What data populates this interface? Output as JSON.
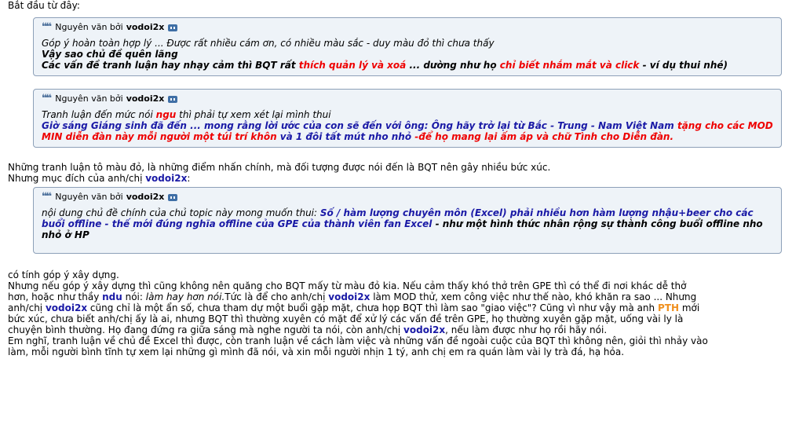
{
  "intro": "Bắt đầu từ đây:",
  "quote_prefix": "Nguyên văn bởi",
  "quote_author": "vodoi2x",
  "quote1": {
    "l1": "Góp ý hoàn toàn hợp lý ... Được rất nhiều cám ơn, có nhiều màu sắc - duy màu đỏ thì chưa thấy",
    "l2": "Vậy sao chủ đề quên lãng",
    "l3a": "Các vấn đề tranh luận hay nhạy cảm thì BQT rất ",
    "l3b": "thích quản lý và xoá",
    "l3c": " ... dường như họ ",
    "l3d": "chỉ biết nhắm mắt và click",
    "l3e": " - ví dụ thui nhé)"
  },
  "quote2": {
    "l1a": "Tranh luận đến mức nói ",
    "l1b": "ngu",
    "l1c": " thì phải tự xem xét lại mình thui",
    "l2a": "Giờ sáng Giáng sinh đã đến ... mong rằng lời ước của con sẽ đến với ông: Ông hãy trở lại từ Bắc - Trung - Nam Việt Nam ",
    "l2b": "tặng cho các MOD",
    "l3a": "MIN diễn đàn này mỗi người một túi trí khôn",
    "l3b": " và 1 đôi tất mút nho nhỏ ",
    "l3c": "-để họ mang lại ấm áp và chữ Tình cho Diễn đàn."
  },
  "para1": "Những tranh luận tô màu đỏ, là những điểm nhấn chính, mà đối tượng được nói đến là BQT nên gây nhiều bức xúc.",
  "para2a": "Nhưng mục đích của anh/chị ",
  "para2b": "vodoi2x",
  "para2c": ":",
  "quote3": {
    "l1a": "nội dung chủ đề chính của chủ topic này mong muốn thui: ",
    "l1b": "Số / hàm lượng chuyên môn (Excel) phải nhiều hơn hàm lượng nhậu+beer cho các",
    "l2a": "buổi offline - thế mới đúng nghĩa offline của GPE của thành viên fan Excel",
    "l2b": " - như một hình thức nhân rộng sự thành công buổi offline nho",
    "l3": "nhỏ ở HP"
  },
  "body": {
    "l1": "có tính góp ý xây dựng.",
    "l2": "Nhưng nếu góp ý xây dựng thì cũng không nên quăng cho BQT mấy từ màu đỏ kia. Nếu cảm thấy khó thở trên GPE thì có thể đi nơi khác dễ thở",
    "l3a": "hơn, hoặc như thầy ",
    "l3b": "ndu",
    "l3c": " nói: ",
    "l3d": "làm hay hơn nói.",
    "l3e": "Tức là để cho anh/chị ",
    "l3f": "vodoi2x",
    "l3g": " làm MOD thử, xem công việc như thế nào, khó khăn ra sao ... Nhưng",
    "l4a": "anh/chị ",
    "l4b": "vodoi2x",
    "l4c": " cũng chỉ là một ẩn số, chưa tham dự một buổi gặp mặt, chưa họp BQT thì làm sao \"giao việc\"? Cũng vì như vậy mà anh ",
    "l4d": "PTH",
    "l4e": " mới",
    "l5": "bức xúc, chưa biết anh/chị ấy là ai, nhưng BQT thì thường xuyên có mặt để xử lý các vấn đề trên GPE, họ thường xuyên gặp mặt, uống vài ly là",
    "l6a": "chuyện bình thường. Họ đang đứng ra giữa sáng mà nghe người ta nói, còn anh/chị ",
    "l6b": "vodoi2x",
    "l6c": ", nếu làm được như họ rồi hãy nói.",
    "l7": "Em nghĩ, tranh luận về chủ đề Excel thì được, còn tranh luận về cách làm việc và những vấn đề ngoài cuộc của BQT thì không nên, giỏi thì nhảy vào",
    "l8": "làm, mỗi người bình tĩnh tự xem lại những gì mình đã nói, và xin mỗi người nhịn 1 tý, anh chị em ra quán làm vài ly trà đá, hạ hỏa."
  },
  "colors": {
    "red": "#ee0000",
    "blue": "#1a1aa6",
    "orange": "#f0901e",
    "quote_bg": "#eef3f8",
    "quote_border": "#8da0b8"
  },
  "icons": {
    "quote_mark": "quote-mark-icon",
    "view_post": "view-post-icon"
  }
}
